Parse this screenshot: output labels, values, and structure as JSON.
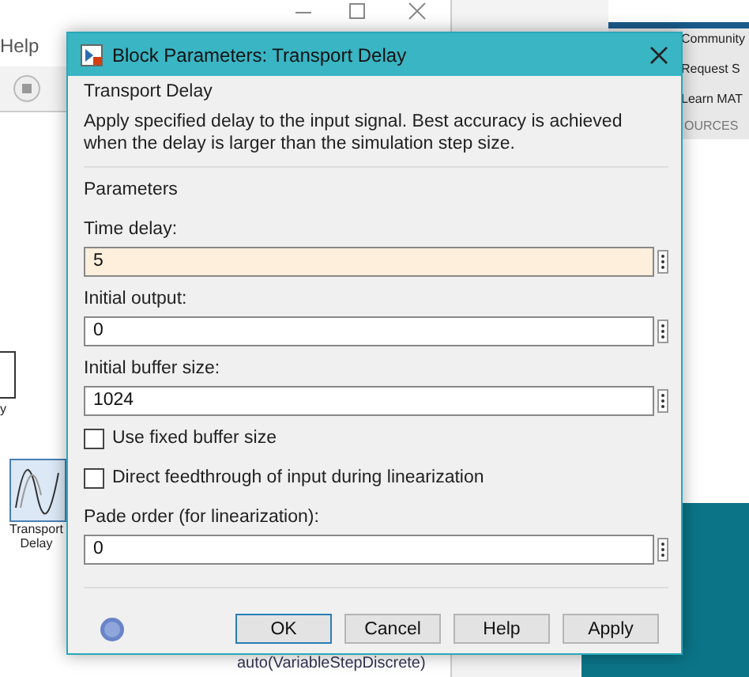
{
  "background": {
    "menu": [
      "Help"
    ],
    "diagram_blocks": [
      {
        "kind": "plain",
        "label": "y"
      },
      {
        "kind": "sine",
        "label": "Transport Delay"
      }
    ],
    "resources_panel": {
      "items": [
        "Community",
        "Request S",
        "Learn MAT"
      ],
      "section": "OURCES"
    },
    "status_bar": "auto(VariableStepDiscrete)"
  },
  "dialog": {
    "title": "Block Parameters: Transport Delay",
    "group": "Transport Delay",
    "description": "Apply specified delay to the input signal.  Best accuracy is achieved when the delay is larger than the simulation step size.",
    "parameters_label": "Parameters",
    "parameters": [
      {
        "kind": "field",
        "label": "Time delay:",
        "value": "5",
        "focused": true
      },
      {
        "kind": "field",
        "label": "Initial output:",
        "value": "0",
        "focused": false
      },
      {
        "kind": "field",
        "label": "Initial buffer size:",
        "value": "1024",
        "focused": false
      },
      {
        "kind": "checkbox",
        "label": "Use fixed buffer size",
        "checked": false
      },
      {
        "kind": "checkbox",
        "label": "Direct feedthrough of input during linearization",
        "checked": false
      },
      {
        "kind": "field",
        "label": "Pade order (for linearization):",
        "value": "0",
        "focused": false
      }
    ],
    "buttons": [
      {
        "label": "OK",
        "default": true
      },
      {
        "label": "Cancel",
        "default": false
      },
      {
        "label": "Help",
        "default": false
      },
      {
        "label": "Apply",
        "default": false
      }
    ]
  }
}
